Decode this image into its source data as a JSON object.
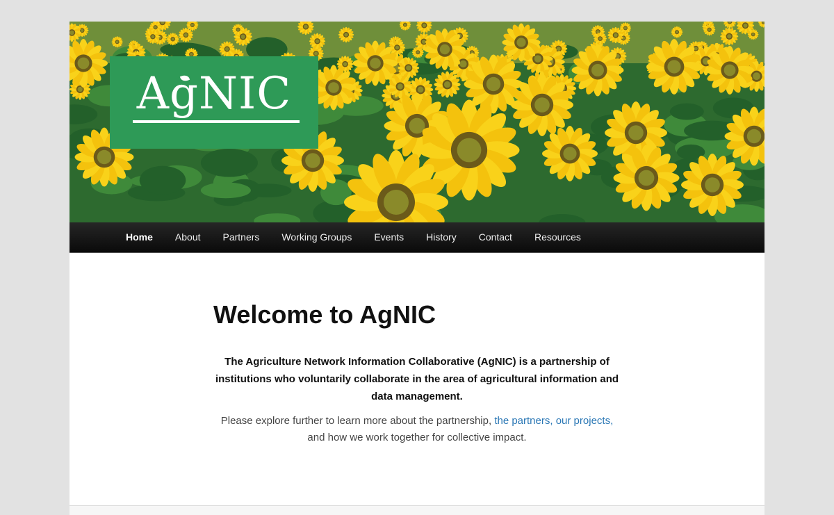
{
  "header": {
    "logo_text": "AgNIC",
    "banner_image": "sunflower-field",
    "logo_color": "#2e9a57"
  },
  "nav": {
    "items": [
      {
        "label": "Home",
        "active": true
      },
      {
        "label": "About"
      },
      {
        "label": "Partners"
      },
      {
        "label": "Working Groups"
      },
      {
        "label": "Events"
      },
      {
        "label": "History"
      },
      {
        "label": "Contact"
      },
      {
        "label": "Resources"
      }
    ]
  },
  "main": {
    "title": "Welcome to AgNIC",
    "lead": "The Agriculture Network Information Collaborative (AgNIC) is a partnership of institutions who voluntarily collaborate in the area of agricultural information and data management.",
    "explore_prefix": "Please explore further to learn more about the partnership,",
    "link_partners": "the partners,",
    "link_projects": "our projects,",
    "explore_suffix": "and how we work together for collective impact."
  },
  "colors": {
    "link": "#2a77b5",
    "nav_bg": "#111111",
    "page_bg": "#e2e2e2"
  }
}
